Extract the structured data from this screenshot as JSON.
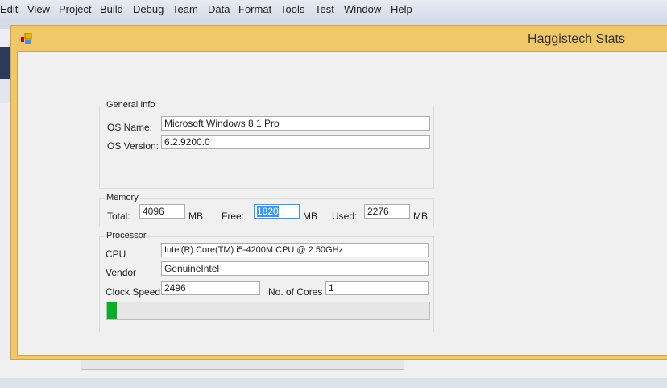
{
  "menu": [
    "Edit",
    "View",
    "Project",
    "Build",
    "Debug",
    "Team",
    "Data",
    "Format",
    "Tools",
    "Test",
    "Window",
    "Help"
  ],
  "window": {
    "title": "Haggistech Stats",
    "icon": "form-app-icon"
  },
  "general_info": {
    "caption": "General Info",
    "os_name_label": "OS Name:",
    "os_name": "Microsoft Windows 8.1 Pro",
    "os_version_label": "OS Version:",
    "os_version": "6.2.9200.0"
  },
  "memory": {
    "caption": "Memory",
    "total_label": "Total:",
    "total": "4096",
    "free_label": "Free:",
    "free": "1820",
    "used_label": "Used:",
    "used": "2276",
    "unit": "MB"
  },
  "processor": {
    "caption": "Processor",
    "cpu_label": "CPU",
    "cpu": "Intel(R) Core(TM) i5-4200M CPU @ 2.50GHz",
    "vendor_label": "Vendor",
    "vendor": "GenuineIntel",
    "clock_label": "Clock Speed",
    "clock": "2496",
    "cores_label": "No. of Cores",
    "cores": "1",
    "usage_percent": 3
  },
  "colors": {
    "title_bar": "#f0c86a",
    "progress": "#06b025"
  }
}
